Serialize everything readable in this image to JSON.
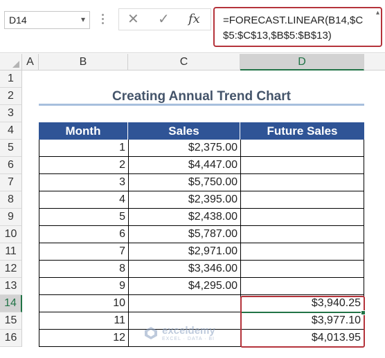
{
  "name_box": {
    "value": "D14"
  },
  "formula_bar": {
    "cancel_icon": "✕",
    "enter_icon": "✓",
    "fx_label": "fx",
    "formula": "=FORECAST.LINEAR(B14,$C$5:$C$13,$B$5:$B$13)"
  },
  "columns": [
    "A",
    "B",
    "C",
    "D"
  ],
  "rows": [
    "1",
    "2",
    "3",
    "4",
    "5",
    "6",
    "7",
    "8",
    "9",
    "10",
    "11",
    "12",
    "13",
    "14",
    "15",
    "16"
  ],
  "title": "Creating Annual Trend Chart",
  "table": {
    "headers": [
      "Month",
      "Sales",
      "Future Sales"
    ],
    "rows": [
      {
        "month": "1",
        "sales": "$2,375.00",
        "future": ""
      },
      {
        "month": "2",
        "sales": "$4,447.00",
        "future": ""
      },
      {
        "month": "3",
        "sales": "$5,750.00",
        "future": ""
      },
      {
        "month": "4",
        "sales": "$2,395.00",
        "future": ""
      },
      {
        "month": "5",
        "sales": "$2,438.00",
        "future": ""
      },
      {
        "month": "6",
        "sales": "$5,787.00",
        "future": ""
      },
      {
        "month": "7",
        "sales": "$2,971.00",
        "future": ""
      },
      {
        "month": "8",
        "sales": "$3,346.00",
        "future": ""
      },
      {
        "month": "9",
        "sales": "$4,295.00",
        "future": ""
      },
      {
        "month": "10",
        "sales": "",
        "future": "$3,940.25"
      },
      {
        "month": "11",
        "sales": "",
        "future": "$3,977.10"
      },
      {
        "month": "12",
        "sales": "",
        "future": "$4,013.95"
      }
    ]
  },
  "watermark": {
    "name": "exceldemy",
    "tagline": "EXCEL · DATA · BI"
  },
  "colors": {
    "header_bg": "#2f5496",
    "title": "#44546a",
    "highlight": "#b4323a",
    "excel_green": "#217346"
  }
}
